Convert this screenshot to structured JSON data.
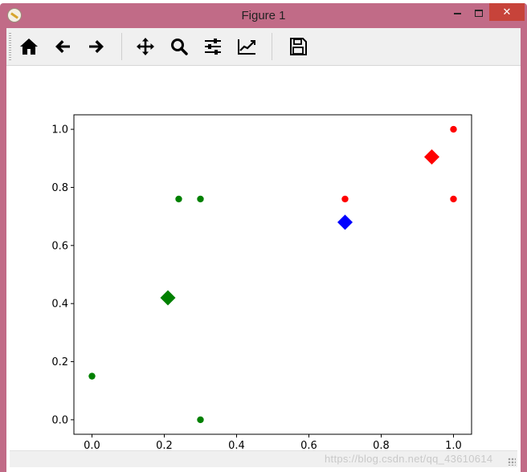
{
  "top_strip_text": "",
  "window": {
    "title": "Figure 1",
    "min_label": "minimize",
    "max_label": "maximize",
    "close_glyph": "✕"
  },
  "toolbar": {
    "buttons": [
      {
        "name": "home-button",
        "icon": "home-icon"
      },
      {
        "name": "back-button",
        "icon": "arrow-left-icon"
      },
      {
        "name": "forward-button",
        "icon": "arrow-right-icon"
      },
      {
        "name": "pan-button",
        "icon": "move-icon"
      },
      {
        "name": "zoom-button",
        "icon": "magnifier-icon"
      },
      {
        "name": "subplots-button",
        "icon": "sliders-icon"
      },
      {
        "name": "customize-button",
        "icon": "line-chart-icon"
      },
      {
        "name": "save-button",
        "icon": "floppy-disk-icon"
      }
    ]
  },
  "status": {
    "text": "",
    "watermark": "https://blog.csdn.net/qq_43610614"
  },
  "colors": {
    "green": "#008000",
    "red": "#ff0000",
    "blue": "#0000ff",
    "titlebar": "#c16b87",
    "close": "#c7433a"
  },
  "chart_data": {
    "type": "scatter",
    "title": "",
    "xlabel": "",
    "ylabel": "",
    "xlim": [
      -0.05,
      1.05
    ],
    "ylim": [
      -0.05,
      1.05
    ],
    "xticks": [
      "0.0",
      "0.2",
      "0.4",
      "0.6",
      "0.8",
      "1.0"
    ],
    "xtick_values": [
      0.0,
      0.2,
      0.4,
      0.6,
      0.8,
      1.0
    ],
    "yticks": [
      "0.0",
      "0.2",
      "0.4",
      "0.6",
      "0.8",
      "1.0"
    ],
    "ytick_values": [
      0.0,
      0.2,
      0.4,
      0.6,
      0.8,
      1.0
    ],
    "grid": false,
    "series": [
      {
        "marker": "circle",
        "color": "#008000",
        "points": [
          [
            0.0,
            0.15
          ],
          [
            0.24,
            0.76
          ],
          [
            0.3,
            0.76
          ],
          [
            0.3,
            0.0
          ]
        ]
      },
      {
        "marker": "circle",
        "color": "#ff0000",
        "points": [
          [
            0.7,
            0.76
          ],
          [
            1.0,
            1.0
          ],
          [
            1.0,
            0.76
          ]
        ]
      },
      {
        "marker": "diamond",
        "color": "#008000",
        "points": [
          [
            0.21,
            0.42
          ]
        ]
      },
      {
        "marker": "diamond",
        "color": "#ff0000",
        "points": [
          [
            0.94,
            0.905
          ]
        ]
      },
      {
        "marker": "diamond",
        "color": "#0000ff",
        "points": [
          [
            0.7,
            0.68
          ]
        ]
      }
    ]
  }
}
